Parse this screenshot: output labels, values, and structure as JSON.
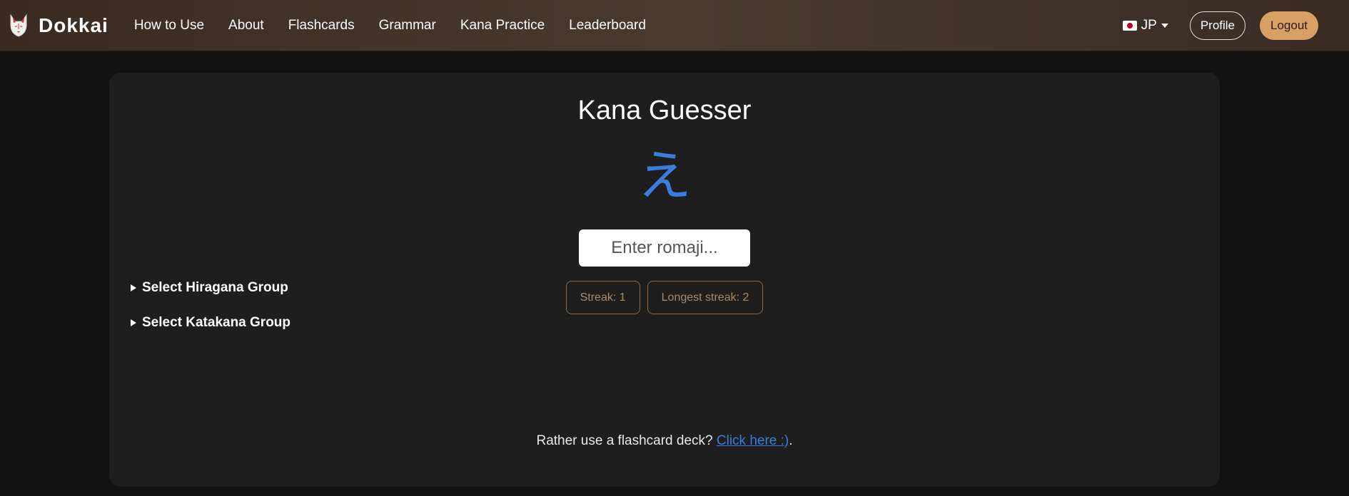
{
  "brand": {
    "name": "Dokkai",
    "logo_icon": "fox-mask-icon"
  },
  "nav": {
    "links": [
      {
        "label": "How to Use"
      },
      {
        "label": "About"
      },
      {
        "label": "Flashcards"
      },
      {
        "label": "Grammar"
      },
      {
        "label": "Kana Practice"
      },
      {
        "label": "Leaderboard"
      }
    ],
    "language": {
      "label": "JP",
      "flag_icon": "japan-flag-icon"
    },
    "profile_label": "Profile",
    "logout_label": "Logout"
  },
  "main": {
    "title": "Kana Guesser",
    "kana": "え",
    "input_placeholder": "Enter romaji...",
    "streak_label": "Streak: 1",
    "longest_streak_label": "Longest streak: 2",
    "hiragana_group_label": "Select Hiragana Group",
    "katakana_group_label": "Select Katakana Group",
    "footer_text": "Rather use a flashcard deck? ",
    "footer_link": "Click here :)",
    "footer_end": "."
  },
  "colors": {
    "accent": "#d9a066",
    "kana": "#3b7ddd",
    "link": "#3b7ddd",
    "card_bg": "#1e1e1e",
    "page_bg": "#121212"
  }
}
